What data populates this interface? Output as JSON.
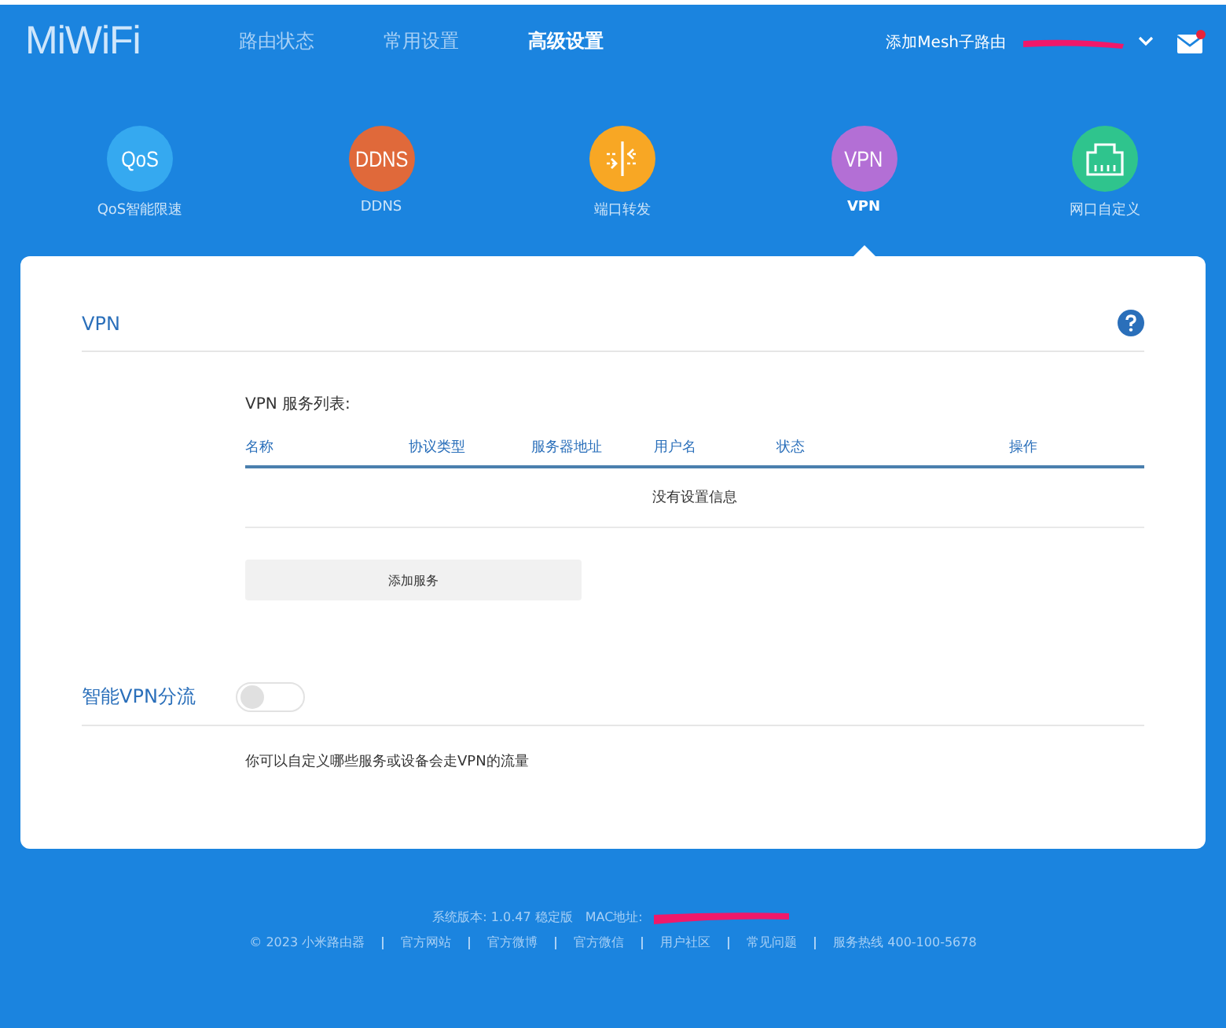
{
  "header": {
    "logo": "MiWiFi",
    "nav": [
      {
        "label": "路由状态",
        "selected": false
      },
      {
        "label": "常用设置",
        "selected": false
      },
      {
        "label": "高级设置",
        "selected": true
      }
    ],
    "mesh_link": "添加Mesh子路由",
    "mail_unread": true
  },
  "features": [
    {
      "kind": "text",
      "icon_text": "QoS",
      "label": "QoS智能限速",
      "color": "#35a9f0",
      "selected": false
    },
    {
      "kind": "text",
      "icon_text": "DDNS",
      "label": "DDNS",
      "color": "#e0693a",
      "selected": false
    },
    {
      "kind": "port",
      "label": "端口转发",
      "color": "#f8a724",
      "selected": false
    },
    {
      "kind": "text",
      "icon_text": "VPN",
      "label": "VPN",
      "color": "#b36fd5",
      "selected": true
    },
    {
      "kind": "lan",
      "label": "网口自定义",
      "color": "#2fc48d",
      "selected": false
    }
  ],
  "vpn": {
    "title": "VPN",
    "list_title": "VPN 服务列表:",
    "columns": [
      "名称",
      "协议类型",
      "服务器地址",
      "用户名",
      "状态",
      "操作"
    ],
    "empty_message": "没有设置信息",
    "add_button": "添加服务"
  },
  "smart_vpn": {
    "label": "智能VPN分流",
    "on": false,
    "description": "你可以自定义哪些服务或设备会走VPN的流量"
  },
  "footer": {
    "version": "系统版本: 1.0.47 稳定版",
    "mac_label": "MAC地址:",
    "links": [
      "© 2023 小米路由器",
      "官方网站",
      "官方微博",
      "官方微信",
      "用户社区",
      "常见问题",
      "服务热线 400-100-5678"
    ]
  }
}
